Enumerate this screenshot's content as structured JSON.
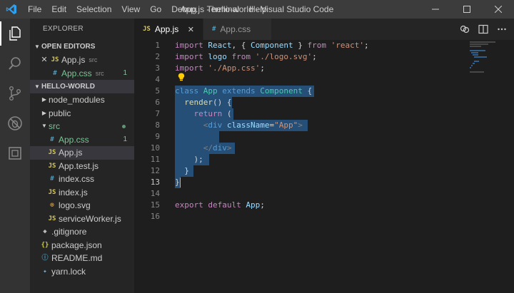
{
  "window": {
    "title": "App.js - hello-world - Visual Studio Code",
    "menu": [
      "File",
      "Edit",
      "Selection",
      "View",
      "Go",
      "Debug",
      "Terminal",
      "Help"
    ]
  },
  "sidebar": {
    "title": "EXPLORER",
    "open_editors": {
      "header": "OPEN EDITORS",
      "items": [
        {
          "name": "App.js",
          "hint": "src",
          "icon": "JS",
          "close": "✕"
        },
        {
          "name": "App.css",
          "hint": "src",
          "icon": "#",
          "badge": "1"
        }
      ]
    },
    "project": {
      "header": "HELLO-WORLD",
      "items": [
        {
          "name": "node_modules",
          "type": "folder"
        },
        {
          "name": "public",
          "type": "folder"
        },
        {
          "name": "src",
          "type": "folder-open"
        },
        {
          "name": "App.css",
          "icon": "#",
          "badge": "1"
        },
        {
          "name": "App.js",
          "icon": "JS"
        },
        {
          "name": "App.test.js",
          "icon": "JS"
        },
        {
          "name": "index.css",
          "icon": "#"
        },
        {
          "name": "index.js",
          "icon": "JS"
        },
        {
          "name": "logo.svg",
          "icon": "⊚"
        },
        {
          "name": "serviceWorker.js",
          "icon": "JS"
        },
        {
          "name": ".gitignore",
          "icon": "◆"
        },
        {
          "name": "package.json",
          "icon": "{}"
        },
        {
          "name": "README.md",
          "icon": "ⓘ"
        },
        {
          "name": "yarn.lock",
          "icon": "✦"
        }
      ]
    }
  },
  "tabs": [
    {
      "label": "App.js",
      "icon": "JS",
      "close": "✕"
    },
    {
      "label": "App.css",
      "icon": "#"
    }
  ],
  "editor": {
    "line_numbers": [
      "1",
      "2",
      "3",
      "4",
      "5",
      "6",
      "7",
      "8",
      "9",
      "10",
      "11",
      "12",
      "13",
      "14",
      "15",
      "16"
    ],
    "current_line": "13"
  }
}
